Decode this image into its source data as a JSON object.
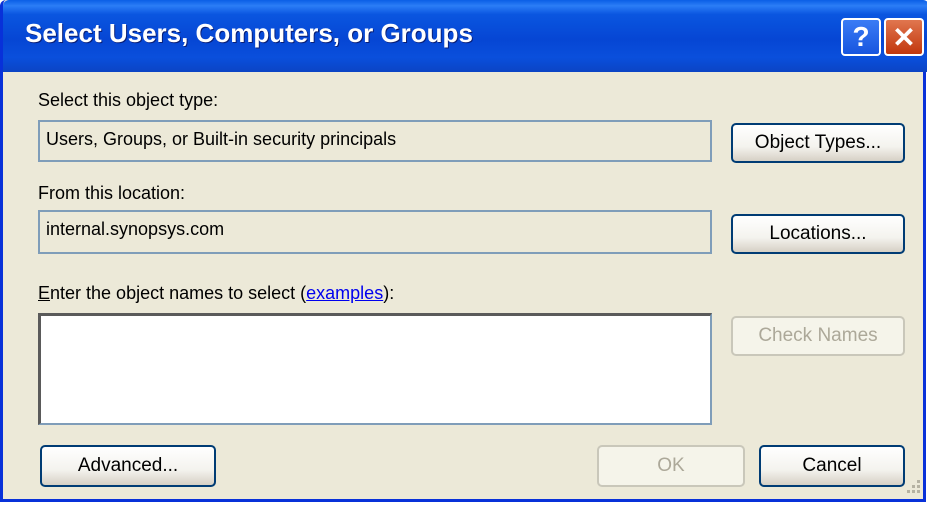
{
  "window": {
    "title": "Select Users, Computers, or Groups",
    "help_glyph": "?",
    "close_glyph": "✕"
  },
  "object_type": {
    "label": "Select this object type:",
    "value": "Users, Groups, or Built-in security principals",
    "button": "Object Types..."
  },
  "location": {
    "label": "From this location:",
    "value": "internal.synopsys.com",
    "button": "Locations..."
  },
  "names": {
    "label_access_key": "E",
    "label_rest": "nter the object names to select (",
    "link": "examples",
    "label_end": "):",
    "value": "",
    "check_button": "Check Names"
  },
  "footer": {
    "advanced": "Advanced...",
    "ok": "OK",
    "cancel": "Cancel"
  },
  "icons": {
    "help": "help-icon",
    "close": "close-icon",
    "resize": "resize-grip-icon"
  },
  "colors": {
    "title_bar": "#0a4fdc",
    "dialog_bg": "#ece9d8",
    "close_button": "#c2370d",
    "link": "#0000ee"
  }
}
